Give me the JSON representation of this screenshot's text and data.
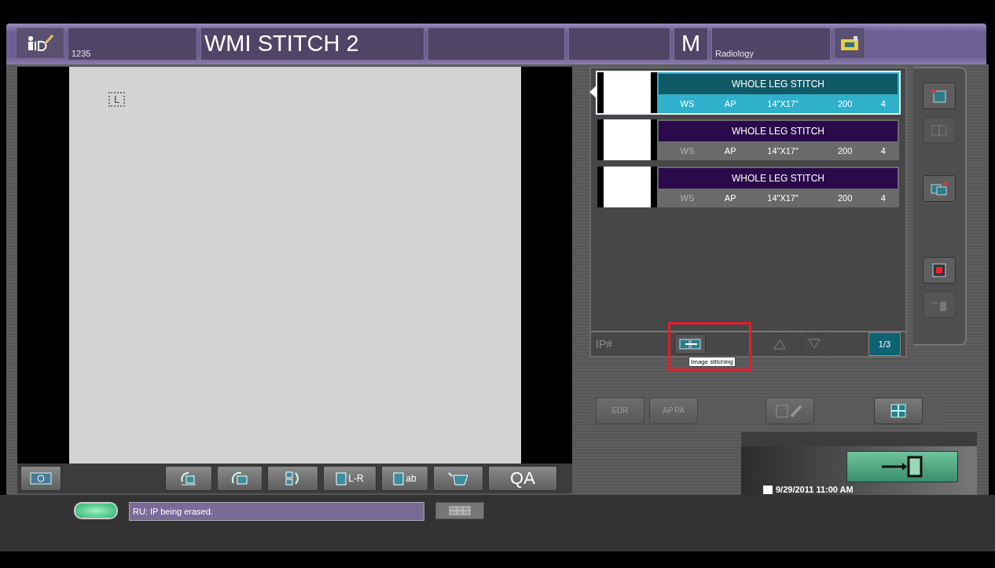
{
  "header": {
    "patient_id": "1235",
    "title": "WMI STITCH 2",
    "sex": "M",
    "department": "Radiology"
  },
  "viewer": {
    "marker": "L",
    "tools": [
      {
        "disabled": false
      },
      {
        "disabled": false
      },
      {
        "disabled": false
      },
      {
        "disabled": false
      },
      {
        "label": "L-R",
        "disabled": false
      },
      {
        "label": "ab",
        "disabled": false
      },
      {
        "disabled": false
      },
      {
        "label": "QA",
        "disabled": false
      }
    ]
  },
  "exposures": [
    {
      "selected": true,
      "title": "WHOLE LEG STITCH",
      "cells": [
        "WS",
        "AP",
        "14\"X17\"",
        "200",
        "4"
      ]
    },
    {
      "selected": false,
      "title": "WHOLE LEG STITCH",
      "cells": [
        "WS",
        "AP",
        "14\"X17\"",
        "200",
        "4"
      ]
    },
    {
      "selected": false,
      "title": "WHOLE LEG STITCH",
      "cells": [
        "WS",
        "AP",
        "14\"X17\"",
        "200",
        "4"
      ]
    }
  ],
  "list_footer": {
    "ip_label": "IP#",
    "ip_disabled": true,
    "stitch_tooltip": "Image stitching",
    "arrows_disabled": true,
    "page": "1/3"
  },
  "side_buttons": [
    {
      "disabled": false
    },
    {
      "disabled": true
    },
    {
      "disabled": false
    },
    {
      "disabled": false
    },
    {
      "disabled": true
    }
  ],
  "actions": [
    {
      "labels": [
        "EDR"
      ],
      "disabled": true
    },
    {
      "labels": [
        "AP",
        "PA"
      ],
      "disabled": true
    },
    {
      "disabled": true
    },
    {
      "disabled": false
    }
  ],
  "status": {
    "indicator_on": true,
    "message": "RU: IP being erased."
  },
  "datetime": "9/29/2011 11:00 AM"
}
